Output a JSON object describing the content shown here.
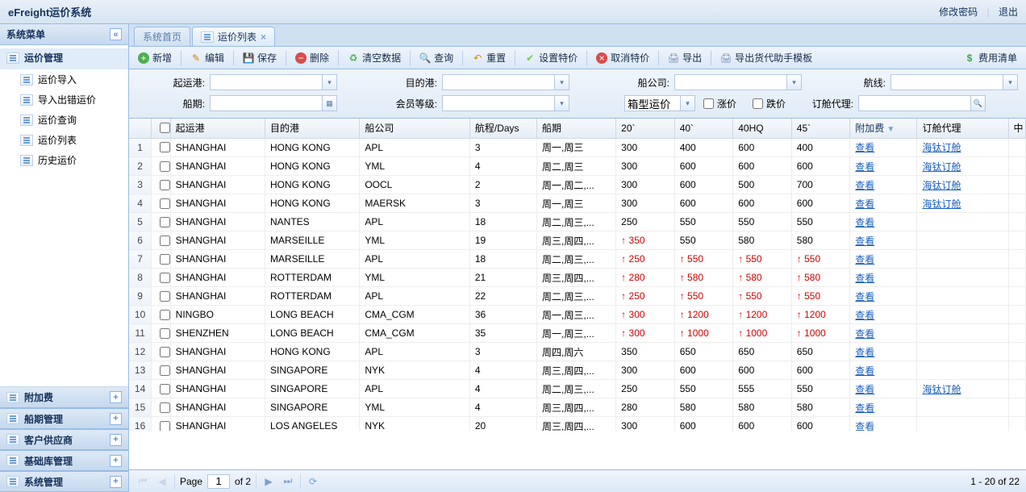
{
  "header": {
    "title": "eFreight运价系统",
    "change_pwd": "修改密码",
    "logout": "退出"
  },
  "sidebar": {
    "title": "系统菜单",
    "group_active": "运价管理",
    "items": [
      "运价导入",
      "导入出错运价",
      "运价查询",
      "运价列表",
      "历史运价"
    ],
    "groups": [
      "附加费",
      "船期管理",
      "客户供应商",
      "基础库管理",
      "系统管理"
    ]
  },
  "tabs": {
    "home": "系统首页",
    "active": "运价列表"
  },
  "toolbar": {
    "add": "新增",
    "edit": "编辑",
    "save": "保存",
    "delete": "删除",
    "clear": "清空数据",
    "search": "查询",
    "reset": "重置",
    "set_special": "设置特价",
    "cancel_special": "取消特价",
    "export": "导出",
    "export_template": "导出货代助手模板",
    "fee_list": "费用清单"
  },
  "filters": {
    "origin": "起运港:",
    "dest": "目的港:",
    "carrier": "船公司:",
    "route": "航线:",
    "schedule": "船期:",
    "level": "会员等级:",
    "box": "箱型运价",
    "box_arrow": "▾",
    "up": "涨价",
    "down": "跌价",
    "agent": "订舱代理:"
  },
  "columns": {
    "rownum": "",
    "chk": "",
    "origin": "起运港",
    "dest": "目的港",
    "carrier": "船公司",
    "voyage": "航程/Days",
    "schedule": "船期",
    "c20": "20`",
    "c40": "40`",
    "c40hq": "40HQ",
    "c45": "45`",
    "surcharge": "附加费",
    "agent": "订舱代理",
    "last": "中"
  },
  "view_text": "查看",
  "agent_text": "海钛订舱",
  "rows": [
    {
      "n": 1,
      "o": "SHANGHAI",
      "d": "HONG KONG",
      "c": "APL",
      "v": "3",
      "s": "周一,周三",
      "p20": {
        "v": "300"
      },
      "p40": {
        "v": "400"
      },
      "p40hq": {
        "v": "600"
      },
      "p45": {
        "v": "400"
      },
      "ag": true
    },
    {
      "n": 2,
      "o": "SHANGHAI",
      "d": "HONG KONG",
      "c": "YML",
      "v": "4",
      "s": "周二,周三",
      "p20": {
        "v": "300"
      },
      "p40": {
        "v": "600"
      },
      "p40hq": {
        "v": "600"
      },
      "p45": {
        "v": "600"
      },
      "ag": true
    },
    {
      "n": 3,
      "o": "SHANGHAI",
      "d": "HONG KONG",
      "c": "OOCL",
      "v": "2",
      "s": "周一,周二,...",
      "p20": {
        "v": "300"
      },
      "p40": {
        "v": "600"
      },
      "p40hq": {
        "v": "500"
      },
      "p45": {
        "v": "700"
      },
      "ag": true
    },
    {
      "n": 4,
      "o": "SHANGHAI",
      "d": "HONG KONG",
      "c": "MAERSK",
      "v": "3",
      "s": "周一,周三",
      "p20": {
        "v": "300"
      },
      "p40": {
        "v": "600"
      },
      "p40hq": {
        "v": "600"
      },
      "p45": {
        "v": "600"
      },
      "ag": true
    },
    {
      "n": 5,
      "o": "SHANGHAI",
      "d": "NANTES",
      "c": "APL",
      "v": "18",
      "s": "周二,周三,...",
      "p20": {
        "v": "250"
      },
      "p40": {
        "v": "550"
      },
      "p40hq": {
        "v": "550"
      },
      "p45": {
        "v": "550"
      },
      "ag": false
    },
    {
      "n": 6,
      "o": "SHANGHAI",
      "d": "MARSEILLE",
      "c": "YML",
      "v": "19",
      "s": "周三,周四,...",
      "p20": {
        "v": "350",
        "u": true
      },
      "p40": {
        "v": "550"
      },
      "p40hq": {
        "v": "580"
      },
      "p45": {
        "v": "580"
      },
      "ag": false
    },
    {
      "n": 7,
      "o": "SHANGHAI",
      "d": "MARSEILLE",
      "c": "APL",
      "v": "18",
      "s": "周二,周三,...",
      "p20": {
        "v": "250",
        "u": true
      },
      "p40": {
        "v": "550",
        "u": true
      },
      "p40hq": {
        "v": "550",
        "u": true
      },
      "p45": {
        "v": "550",
        "u": true
      },
      "ag": false
    },
    {
      "n": 8,
      "o": "SHANGHAI",
      "d": "ROTTERDAM",
      "c": "YML",
      "v": "21",
      "s": "周三,周四,...",
      "p20": {
        "v": "280",
        "u": true
      },
      "p40": {
        "v": "580",
        "u": true
      },
      "p40hq": {
        "v": "580",
        "u": true
      },
      "p45": {
        "v": "580",
        "u": true
      },
      "ag": false
    },
    {
      "n": 9,
      "o": "SHANGHAI",
      "d": "ROTTERDAM",
      "c": "APL",
      "v": "22",
      "s": "周二,周三,...",
      "p20": {
        "v": "250",
        "u": true
      },
      "p40": {
        "v": "550",
        "u": true
      },
      "p40hq": {
        "v": "550",
        "u": true
      },
      "p45": {
        "v": "550",
        "u": true
      },
      "ag": false
    },
    {
      "n": 10,
      "o": "NINGBO",
      "d": "LONG BEACH",
      "c": "CMA_CGM",
      "v": "36",
      "s": "周一,周三,...",
      "p20": {
        "v": "300",
        "u": true
      },
      "p40": {
        "v": "1200",
        "u": true
      },
      "p40hq": {
        "v": "1200",
        "u": true
      },
      "p45": {
        "v": "1200",
        "u": true
      },
      "ag": false
    },
    {
      "n": 11,
      "o": "SHENZHEN",
      "d": "LONG BEACH",
      "c": "CMA_CGM",
      "v": "35",
      "s": "周一,周三,...",
      "p20": {
        "v": "300",
        "u": true
      },
      "p40": {
        "v": "1000",
        "u": true
      },
      "p40hq": {
        "v": "1000",
        "u": true
      },
      "p45": {
        "v": "1000",
        "u": true
      },
      "ag": false
    },
    {
      "n": 12,
      "o": "SHANGHAI",
      "d": "HONG KONG",
      "c": "APL",
      "v": "3",
      "s": "周四,周六",
      "p20": {
        "v": "350"
      },
      "p40": {
        "v": "650"
      },
      "p40hq": {
        "v": "650"
      },
      "p45": {
        "v": "650"
      },
      "ag": false
    },
    {
      "n": 13,
      "o": "SHANGHAI",
      "d": "SINGAPORE",
      "c": "NYK",
      "v": "4",
      "s": "周三,周四,...",
      "p20": {
        "v": "300"
      },
      "p40": {
        "v": "600"
      },
      "p40hq": {
        "v": "600"
      },
      "p45": {
        "v": "600"
      },
      "ag": false
    },
    {
      "n": 14,
      "o": "SHANGHAI",
      "d": "SINGAPORE",
      "c": "APL",
      "v": "4",
      "s": "周二,周三,...",
      "p20": {
        "v": "250"
      },
      "p40": {
        "v": "550"
      },
      "p40hq": {
        "v": "555"
      },
      "p45": {
        "v": "550"
      },
      "ag": true
    },
    {
      "n": 15,
      "o": "SHANGHAI",
      "d": "SINGAPORE",
      "c": "YML",
      "v": "4",
      "s": "周三,周四,...",
      "p20": {
        "v": "280"
      },
      "p40": {
        "v": "580"
      },
      "p40hq": {
        "v": "580"
      },
      "p45": {
        "v": "580"
      },
      "ag": false
    },
    {
      "n": 16,
      "o": "SHANGHAI",
      "d": "LOS ANGELES",
      "c": "NYK",
      "v": "20",
      "s": "周三,周四,...",
      "p20": {
        "v": "300"
      },
      "p40": {
        "v": "600"
      },
      "p40hq": {
        "v": "600"
      },
      "p45": {
        "v": "600"
      },
      "ag": false
    }
  ],
  "pager": {
    "page_label": "Page",
    "page": "1",
    "of": "of 2",
    "info": "1 - 20 of 22"
  }
}
